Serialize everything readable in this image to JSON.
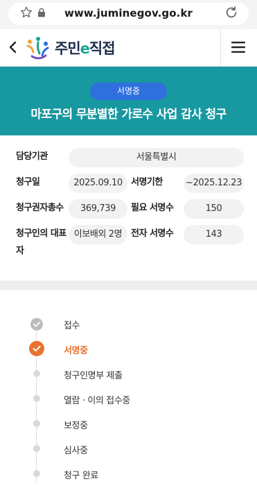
{
  "browser": {
    "url": "www.juminegov.go.kr",
    "bookmark_icon": "star-outline-icon",
    "lock_icon": "lock-icon",
    "reload_icon": "reload-icon"
  },
  "header": {
    "logo_prefix": "주민",
    "logo_e": "e",
    "logo_suffix": "직접",
    "back_icon": "chevron-left-icon",
    "menu_icon": "hamburger-menu-icon"
  },
  "banner": {
    "status_badge": "서명중",
    "title": "마포구의 무분별한 가로수 사업 감사 청구",
    "background_color": "#1898a0",
    "badge_color": "#2f6fde"
  },
  "info": {
    "agency_label": "담당기관",
    "agency_value": "서울특별시",
    "request_date_label": "청구일",
    "request_date_value": "2025.09.10",
    "deadline_label": "서명기한",
    "deadline_value": "~2025.12.23",
    "total_eligible_label": "청구권자총수",
    "total_eligible_value": "369,739",
    "required_label": "필요 서명수",
    "required_value": "150",
    "representative_label_line1": "청구인의 대표",
    "representative_label_line2": "자",
    "representative_value": "이보배외 2명",
    "electronic_label": "전자 서명수",
    "electronic_value": "143"
  },
  "progress": {
    "accent_color": "#e8732e",
    "steps": [
      {
        "label": "접수",
        "state": "done"
      },
      {
        "label": "서명중",
        "state": "current"
      },
      {
        "label": "청구인명부 제출",
        "state": "pending"
      },
      {
        "label": "열람 · 이의 접수중",
        "state": "pending"
      },
      {
        "label": "보정중",
        "state": "pending"
      },
      {
        "label": "심사중",
        "state": "pending"
      },
      {
        "label": "청구 완료",
        "state": "pending"
      }
    ]
  }
}
